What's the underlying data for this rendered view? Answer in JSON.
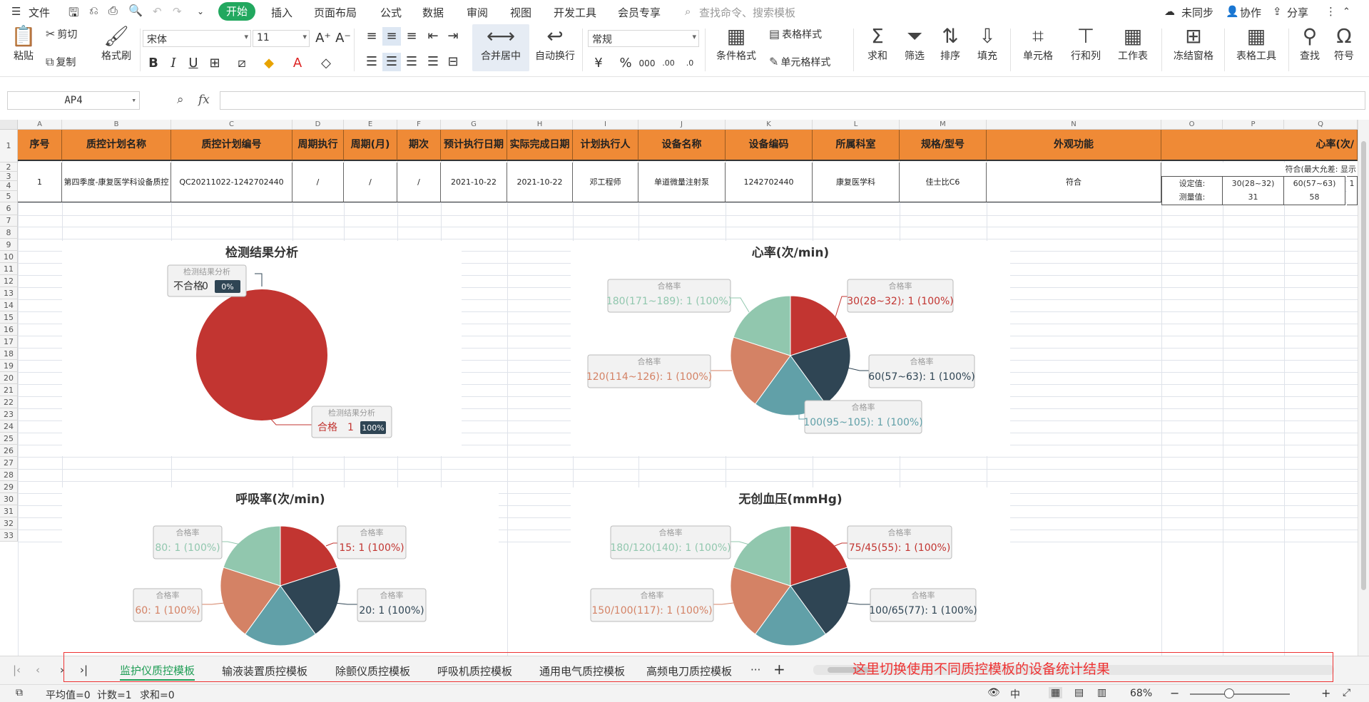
{
  "menubar": {
    "file": "文件",
    "tabs": [
      "开始",
      "插入",
      "页面布局",
      "公式",
      "数据",
      "审阅",
      "视图",
      "开发工具",
      "会员专享"
    ],
    "search_placeholder": "查找命令、搜索模板",
    "sync": "未同步",
    "collab": "协作",
    "share": "分享"
  },
  "ribbon": {
    "paste": "粘贴",
    "cut": "剪切",
    "copy": "复制",
    "format_painter": "格式刷",
    "font_name": "宋体",
    "font_size": "11",
    "merge_center": "合并居中",
    "wrap_text": "自动换行",
    "number_format": "常规",
    "cond_format": "条件格式",
    "table_style": "表格样式",
    "cell_style": "单元格样式",
    "sum": "求和",
    "filter": "筛选",
    "sort": "排序",
    "fill": "填充",
    "cell": "单元格",
    "row_col": "行和列",
    "worksheet": "工作表",
    "freeze": "冻结窗格",
    "table_tools": "表格工具",
    "find": "查找",
    "symbol": "符号"
  },
  "formula_bar": {
    "name_box": "AP4",
    "fx": "fx",
    "content": ""
  },
  "columns": [
    "A",
    "B",
    "C",
    "D",
    "E",
    "F",
    "G",
    "H",
    "I",
    "J",
    "K",
    "L",
    "M",
    "N",
    "O",
    "P",
    "Q"
  ],
  "rows": [
    "1",
    "2",
    "3",
    "4",
    "5",
    "6",
    "7",
    "8",
    "9",
    "10",
    "11",
    "12",
    "13",
    "14",
    "15",
    "16",
    "17",
    "18",
    "19",
    "20",
    "21",
    "22",
    "23",
    "24",
    "25",
    "26",
    "27",
    "28",
    "29",
    "30",
    "31",
    "32",
    "33"
  ],
  "table": {
    "headers": [
      "序号",
      "质控计划名称",
      "质控计划编号",
      "周期执行",
      "周期(月)",
      "期次",
      "预计执行日期",
      "实际完成日期",
      "计划执行人",
      "设备名称",
      "设备编码",
      "所属科室",
      "规格/型号",
      "外观功能",
      "心率(次/"
    ],
    "row": [
      "1",
      "第四季度-康复医学科设备质控",
      "QC20211022-1242702440",
      "/",
      "/",
      "/",
      "2021-10-22",
      "2021-10-22",
      "邓工程师",
      "单道微量注射泵",
      "1242702440",
      "康复医学科",
      "佳士比C6",
      "符合"
    ],
    "hr_note": "符合(最大允差: 显示",
    "set_label": "设定值:",
    "meas_label": "测量值:",
    "set_values": [
      "30(28~32)",
      "60(57~63)",
      "1"
    ],
    "meas_values": [
      "31",
      "58",
      ""
    ]
  },
  "charts": [
    {
      "title": "检测结果分析",
      "chart_data": {
        "type": "pie",
        "title": "检测结果分析",
        "slices": [
          {
            "label": "合格",
            "value": 1,
            "percent": "100%",
            "color": "#c23531"
          },
          {
            "label": "不合格",
            "value": 0,
            "percent": "0%",
            "color": "#2f4554"
          }
        ],
        "tooltip_title": "检测结果分析"
      }
    },
    {
      "title": "心率(次/min)",
      "chart_data": {
        "type": "pie",
        "title": "心率(次/min)",
        "tooltip_title": "合格率",
        "slices": [
          {
            "label": "30(28~32): 1 (100%)",
            "value": 1,
            "color": "#c23531"
          },
          {
            "label": "60(57~63): 1 (100%)",
            "value": 1,
            "color": "#2f4554"
          },
          {
            "label": "100(95~105): 1 (100%)",
            "value": 1,
            "color": "#61a0a8"
          },
          {
            "label": "120(114~126): 1 (100%)",
            "value": 1,
            "color": "#d48265"
          },
          {
            "label": "180(171~189): 1 (100%)",
            "value": 1,
            "color": "#91c7ae"
          }
        ]
      }
    },
    {
      "title": "呼吸率(次/min)",
      "chart_data": {
        "type": "pie",
        "title": "呼吸率(次/min)",
        "tooltip_title": "合格率",
        "slices": [
          {
            "label": "15: 1 (100%)",
            "value": 1,
            "color": "#c23531"
          },
          {
            "label": "20: 1 (100%)",
            "value": 1,
            "color": "#2f4554"
          },
          {
            "label": "",
            "value": 1,
            "color": "#61a0a8"
          },
          {
            "label": "60: 1 (100%)",
            "value": 1,
            "color": "#d48265"
          },
          {
            "label": "80: 1 (100%)",
            "value": 1,
            "color": "#91c7ae"
          }
        ]
      }
    },
    {
      "title": "无创血压(mmHg)",
      "chart_data": {
        "type": "pie",
        "title": "无创血压(mmHg)",
        "tooltip_title": "合格率",
        "slices": [
          {
            "label": "75/45(55): 1 (100%)",
            "value": 1,
            "color": "#c23531"
          },
          {
            "label": "100/65(77): 1 (100%)",
            "value": 1,
            "color": "#2f4554"
          },
          {
            "label": "",
            "value": 1,
            "color": "#61a0a8"
          },
          {
            "label": "150/100(117): 1 (100%)",
            "value": 1,
            "color": "#d48265"
          },
          {
            "label": "180/120(140): 1 (100%)",
            "value": 1,
            "color": "#91c7ae"
          }
        ]
      }
    }
  ],
  "sheet_tabs": [
    "监护仪质控模板",
    "输液装置质控模板",
    "除颤仪质控模板",
    "呼吸机质控模板",
    "通用电气质控模板",
    "高频电刀质控模板"
  ],
  "active_tab": 0,
  "tab_more": "···",
  "tab_add": "+",
  "annotation": "这里切换使用不同质控模板的设备统计结果",
  "status": {
    "avg": "平均值=0",
    "count": "计数=1",
    "sum": "求和=0",
    "zoom": "68%"
  }
}
